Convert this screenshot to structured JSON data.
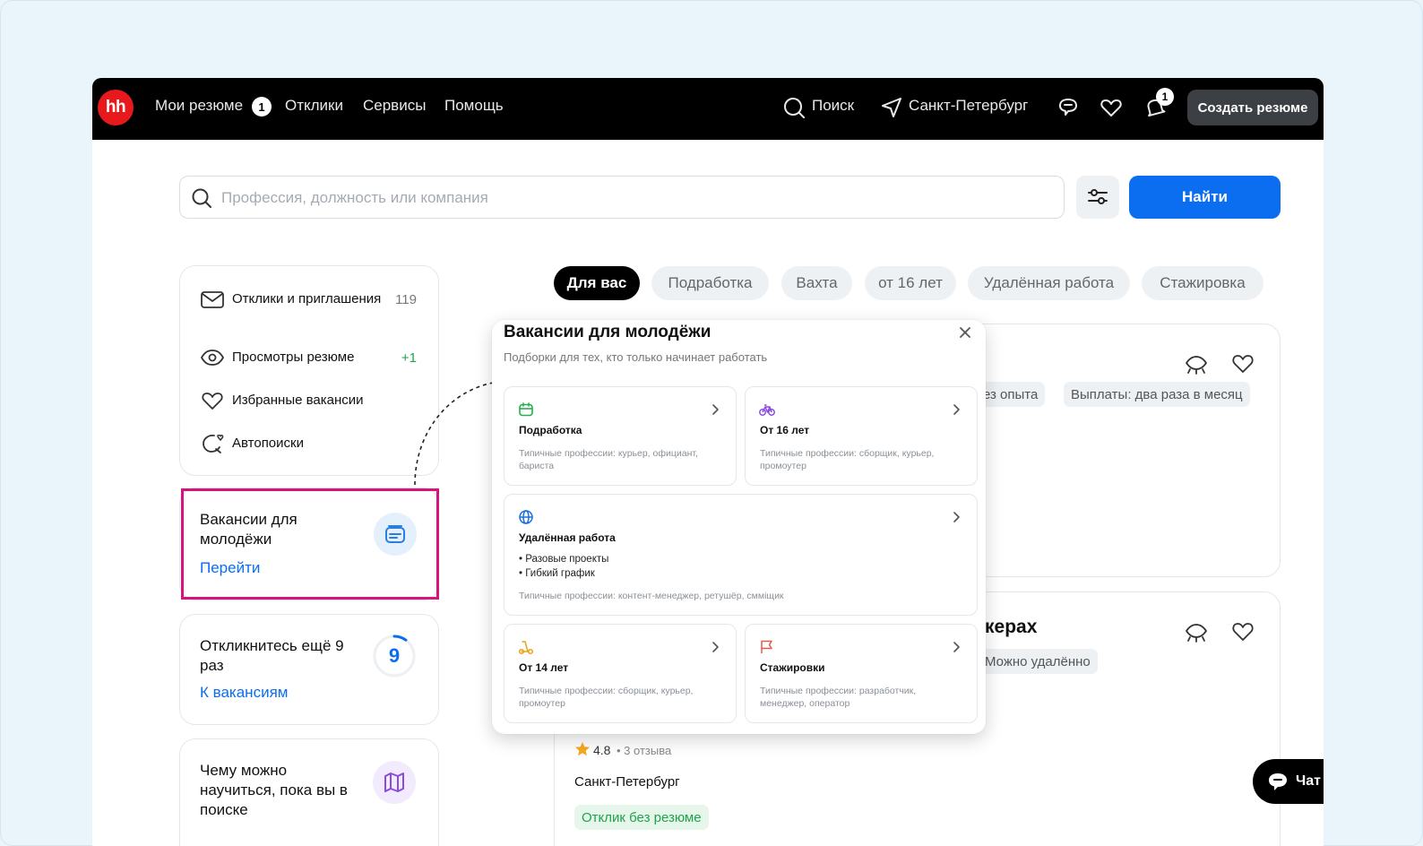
{
  "nav": {
    "logo": "hh",
    "my_resumes": "Мои резюме",
    "my_resumes_badge": "1",
    "responses": "Отклики",
    "services": "Сервисы",
    "help": "Помощь",
    "search": "Поиск",
    "city": "Санкт-Петербург",
    "notifications_badge": "1",
    "create_resume": "Создать резюме"
  },
  "search": {
    "placeholder": "Профессия, должность или компания",
    "value": "",
    "find_label": "Найти"
  },
  "sidebar": {
    "items": [
      {
        "label": "Отклики и приглашения",
        "count": "119",
        "icon": "mail-icon"
      },
      {
        "label": "Просмотры резюме",
        "count": "+1",
        "icon": "eye-icon"
      },
      {
        "label": "Избранные вакансии",
        "count": "",
        "icon": "heart-icon"
      },
      {
        "label": "Автопоиски",
        "count": "",
        "icon": "autosearch-icon"
      }
    ],
    "youth_card": {
      "title": "Вакансии для молодёжи",
      "link": "Перейти"
    },
    "respond_card": {
      "title": "Откликнитесь ещё 9 раз",
      "link": "К вакансиям",
      "counter": "9",
      "progress": 0.1
    },
    "learn_card": {
      "title": "Чему можно научиться, пока вы в поиске"
    }
  },
  "tabs": [
    {
      "label": "Для вас",
      "active": true
    },
    {
      "label": "Подработка",
      "active": false
    },
    {
      "label": "Вахта",
      "active": false
    },
    {
      "label": "от 16 лет",
      "active": false
    },
    {
      "label": "Удалённая работа",
      "active": false
    },
    {
      "label": "Стажировка",
      "active": false
    }
  ],
  "vacancies": {
    "card1": {
      "chip_experience": "ез опыта",
      "chip_payment": "Выплаты: два раза в месяц"
    },
    "card2": {
      "title_fragment": "керах",
      "chip_remote": "Можно удалённо",
      "rating": "4.8",
      "reviews": "• 3 отзыва",
      "city": "Санкт-Петербург",
      "no_resume": "Отклик без резюме"
    }
  },
  "popup": {
    "title": "Вакансии для молодёжи",
    "subtitle": "Подборки для тех, кто только начинает работать",
    "options": [
      {
        "title": "Подработка",
        "desc": "Типичные профессии: курьер, официант, бариста",
        "icon": "calendar-icon"
      },
      {
        "title": "От 16 лет",
        "desc": "Типичные профессии: сборщик, курьер, промоутер",
        "icon": "bicycle-icon"
      },
      {
        "title": "Удалённая работа",
        "bullets": [
          "• Разовые проекты",
          "• Гибкий график"
        ],
        "desc": "Типичные профессии: контент-менеджер, ретушёр, смміщик",
        "icon": "globe-icon"
      },
      {
        "title": "От 14 лет",
        "desc": "Типичные профессии: сборщик, курьер, промоутер",
        "icon": "scooter-icon"
      },
      {
        "title": "Стажировки",
        "desc": "Типичные профессии: разработчик, менеджер, оператор",
        "icon": "flag-icon"
      }
    ]
  },
  "chat": {
    "label": "Чат"
  },
  "colors": {
    "brand_red": "#e8191d",
    "accent_blue": "#0b6ef0",
    "highlight_pink": "#d7147c",
    "success_green": "#1fa34c"
  }
}
